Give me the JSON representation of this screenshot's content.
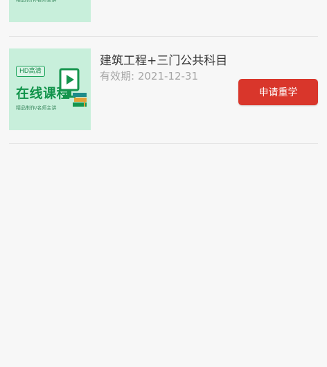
{
  "thumbnail": {
    "badge": "HD高清",
    "title": "在线课程",
    "subtitle": "精品制作/名师主讲"
  },
  "courses": [
    {
      "title": "",
      "expire": ""
    },
    {
      "title": "建筑工程+三门公共科目",
      "expire": "有效期: 2021-12-31",
      "button_label": "申请重学"
    }
  ],
  "colors": {
    "background": "#f7f7f7",
    "thumbnail_bg": "#c8efdb",
    "thumbnail_text": "#10934a",
    "button_bg": "#d9362b",
    "button_text": "#ffffff",
    "title_text": "#333333",
    "expire_text": "#a5a5a5",
    "divider": "#e2e2e2"
  },
  "icons": {
    "thumbnail_device": "monitor-with-books-icon"
  }
}
